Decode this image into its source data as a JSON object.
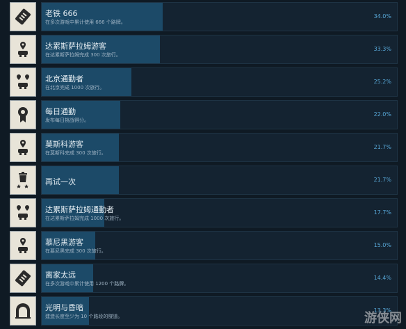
{
  "colors": {
    "background": "#0f1a24",
    "bar_fill": "#1c4a68",
    "percent_text": "#58a8d8"
  },
  "achievements": [
    {
      "icon": "tickets-icon",
      "title": "老铁 666",
      "desc": "在多次游戏中累计使用 666 个路牌。",
      "percent": "34.0%",
      "fill": 0.34
    },
    {
      "icon": "map-pin-car-icon",
      "title": "达累斯萨拉姆游客",
      "desc": "在达累斯萨拉姆完成 300 次旅行。",
      "percent": "33.3%",
      "fill": 0.333
    },
    {
      "icon": "map-pins-car-icon",
      "title": "北京通勤者",
      "desc": "在北京完成 1000 次旅行。",
      "percent": "25.2%",
      "fill": 0.252
    },
    {
      "icon": "medal-icon",
      "title": "每日通勤",
      "desc": "发布每日挑战得分。",
      "percent": "22.0%",
      "fill": 0.22
    },
    {
      "icon": "map-pin-car-icon",
      "title": "莫斯科游客",
      "desc": "在莫斯科完成 300 次旅行。",
      "percent": "21.7%",
      "fill": 0.217
    },
    {
      "icon": "trash-stars-icon",
      "title": "再试一次",
      "desc": "",
      "percent": "21.7%",
      "fill": 0.217
    },
    {
      "icon": "map-pins-car-icon",
      "title": "达累斯萨拉姆通勤者",
      "desc": "在达累斯萨拉姆完成 1000 次旅行。",
      "percent": "17.7%",
      "fill": 0.177
    },
    {
      "icon": "map-pin-car-icon",
      "title": "慕尼黑游客",
      "desc": "在慕尼黑完成 300 次旅行。",
      "percent": "15.0%",
      "fill": 0.15
    },
    {
      "icon": "tickets-icon",
      "title": "离家太远",
      "desc": "在多次游戏中累计使用 1200 个路牌。",
      "percent": "14.4%",
      "fill": 0.144
    },
    {
      "icon": "tunnel-icon",
      "title": "光明与昏暗",
      "desc": "建造长度至少为 10 个路段的隧道。",
      "percent": "13.3%",
      "fill": 0.133
    }
  ],
  "watermark": "游侠网"
}
